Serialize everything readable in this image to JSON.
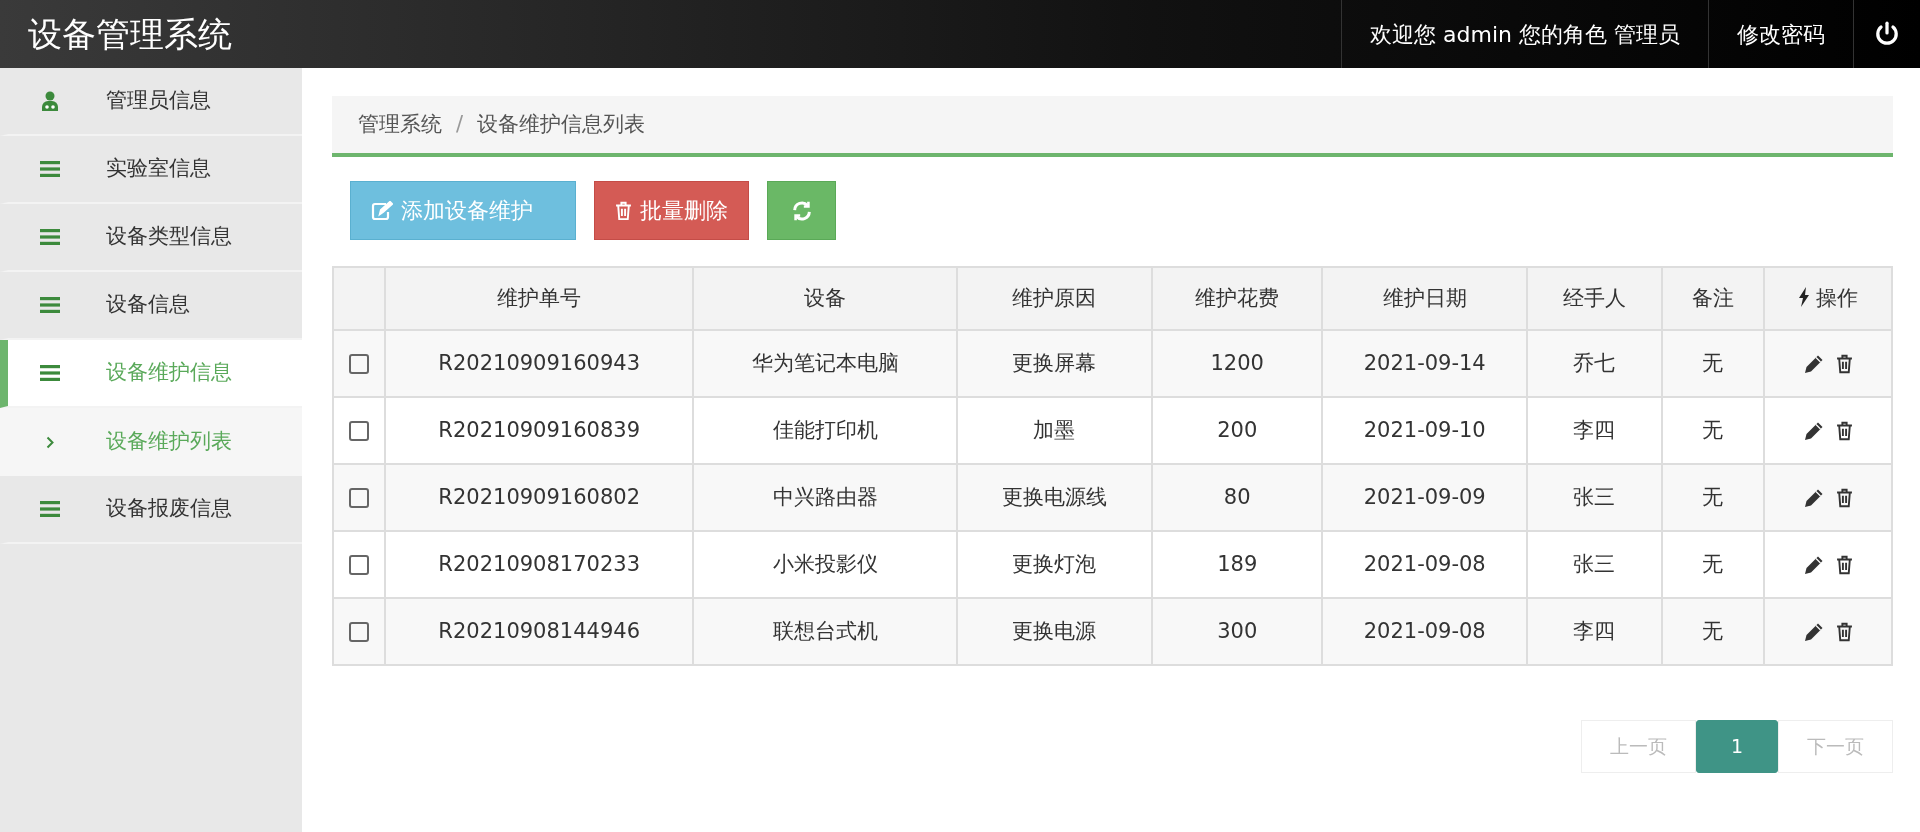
{
  "header": {
    "title": "设备管理系统",
    "welcome": "欢迎您 admin 您的角色 管理员",
    "change_password": "修改密码"
  },
  "sidebar": {
    "items": [
      {
        "label": "管理员信息",
        "kind": "user",
        "selected": false
      },
      {
        "label": "实验室信息",
        "kind": "menu",
        "selected": false
      },
      {
        "label": "设备类型信息",
        "kind": "menu",
        "selected": false
      },
      {
        "label": "设备信息",
        "kind": "menu",
        "selected": false
      },
      {
        "label": "设备维护信息",
        "kind": "menu",
        "selected": true,
        "children": [
          {
            "label": "设备维护列表",
            "selected": true
          }
        ]
      },
      {
        "label": "设备报废信息",
        "kind": "menu",
        "selected": false
      }
    ]
  },
  "breadcrumb": {
    "items": [
      "管理系统",
      "设备维护信息列表"
    ],
    "separator": "/"
  },
  "toolbar": {
    "add": "添加设备维护",
    "batch_delete": "批量删除"
  },
  "table": {
    "columns": [
      "维护单号",
      "设备",
      "维护原因",
      "维护花费",
      "维护日期",
      "经手人",
      "备注",
      "操作"
    ],
    "rows": [
      {
        "checked": false,
        "cells": [
          "R20210909160943",
          "华为笔记本电脑",
          "更换屏幕",
          "1200",
          "2021-09-14",
          "乔七",
          "无"
        ]
      },
      {
        "checked": false,
        "cells": [
          "R20210909160839",
          "佳能打印机",
          "加墨",
          "200",
          "2021-09-10",
          "李四",
          "无"
        ]
      },
      {
        "checked": false,
        "cells": [
          "R20210909160802",
          "中兴路由器",
          "更换电源线",
          "80",
          "2021-09-09",
          "张三",
          "无"
        ]
      },
      {
        "checked": false,
        "cells": [
          "R20210908170233",
          "小米投影仪",
          "更换灯泡",
          "189",
          "2021-09-08",
          "张三",
          "无"
        ]
      },
      {
        "checked": false,
        "cells": [
          "R20210908144946",
          "联想台式机",
          "更换电源",
          "300",
          "2021-09-08",
          "李四",
          "无"
        ]
      }
    ]
  },
  "pagination": [
    {
      "label": "上一页",
      "selected": false,
      "disabled": true
    },
    {
      "label": "1",
      "selected": true,
      "disabled": false
    },
    {
      "label": "下一页",
      "selected": false,
      "disabled": true
    }
  ]
}
